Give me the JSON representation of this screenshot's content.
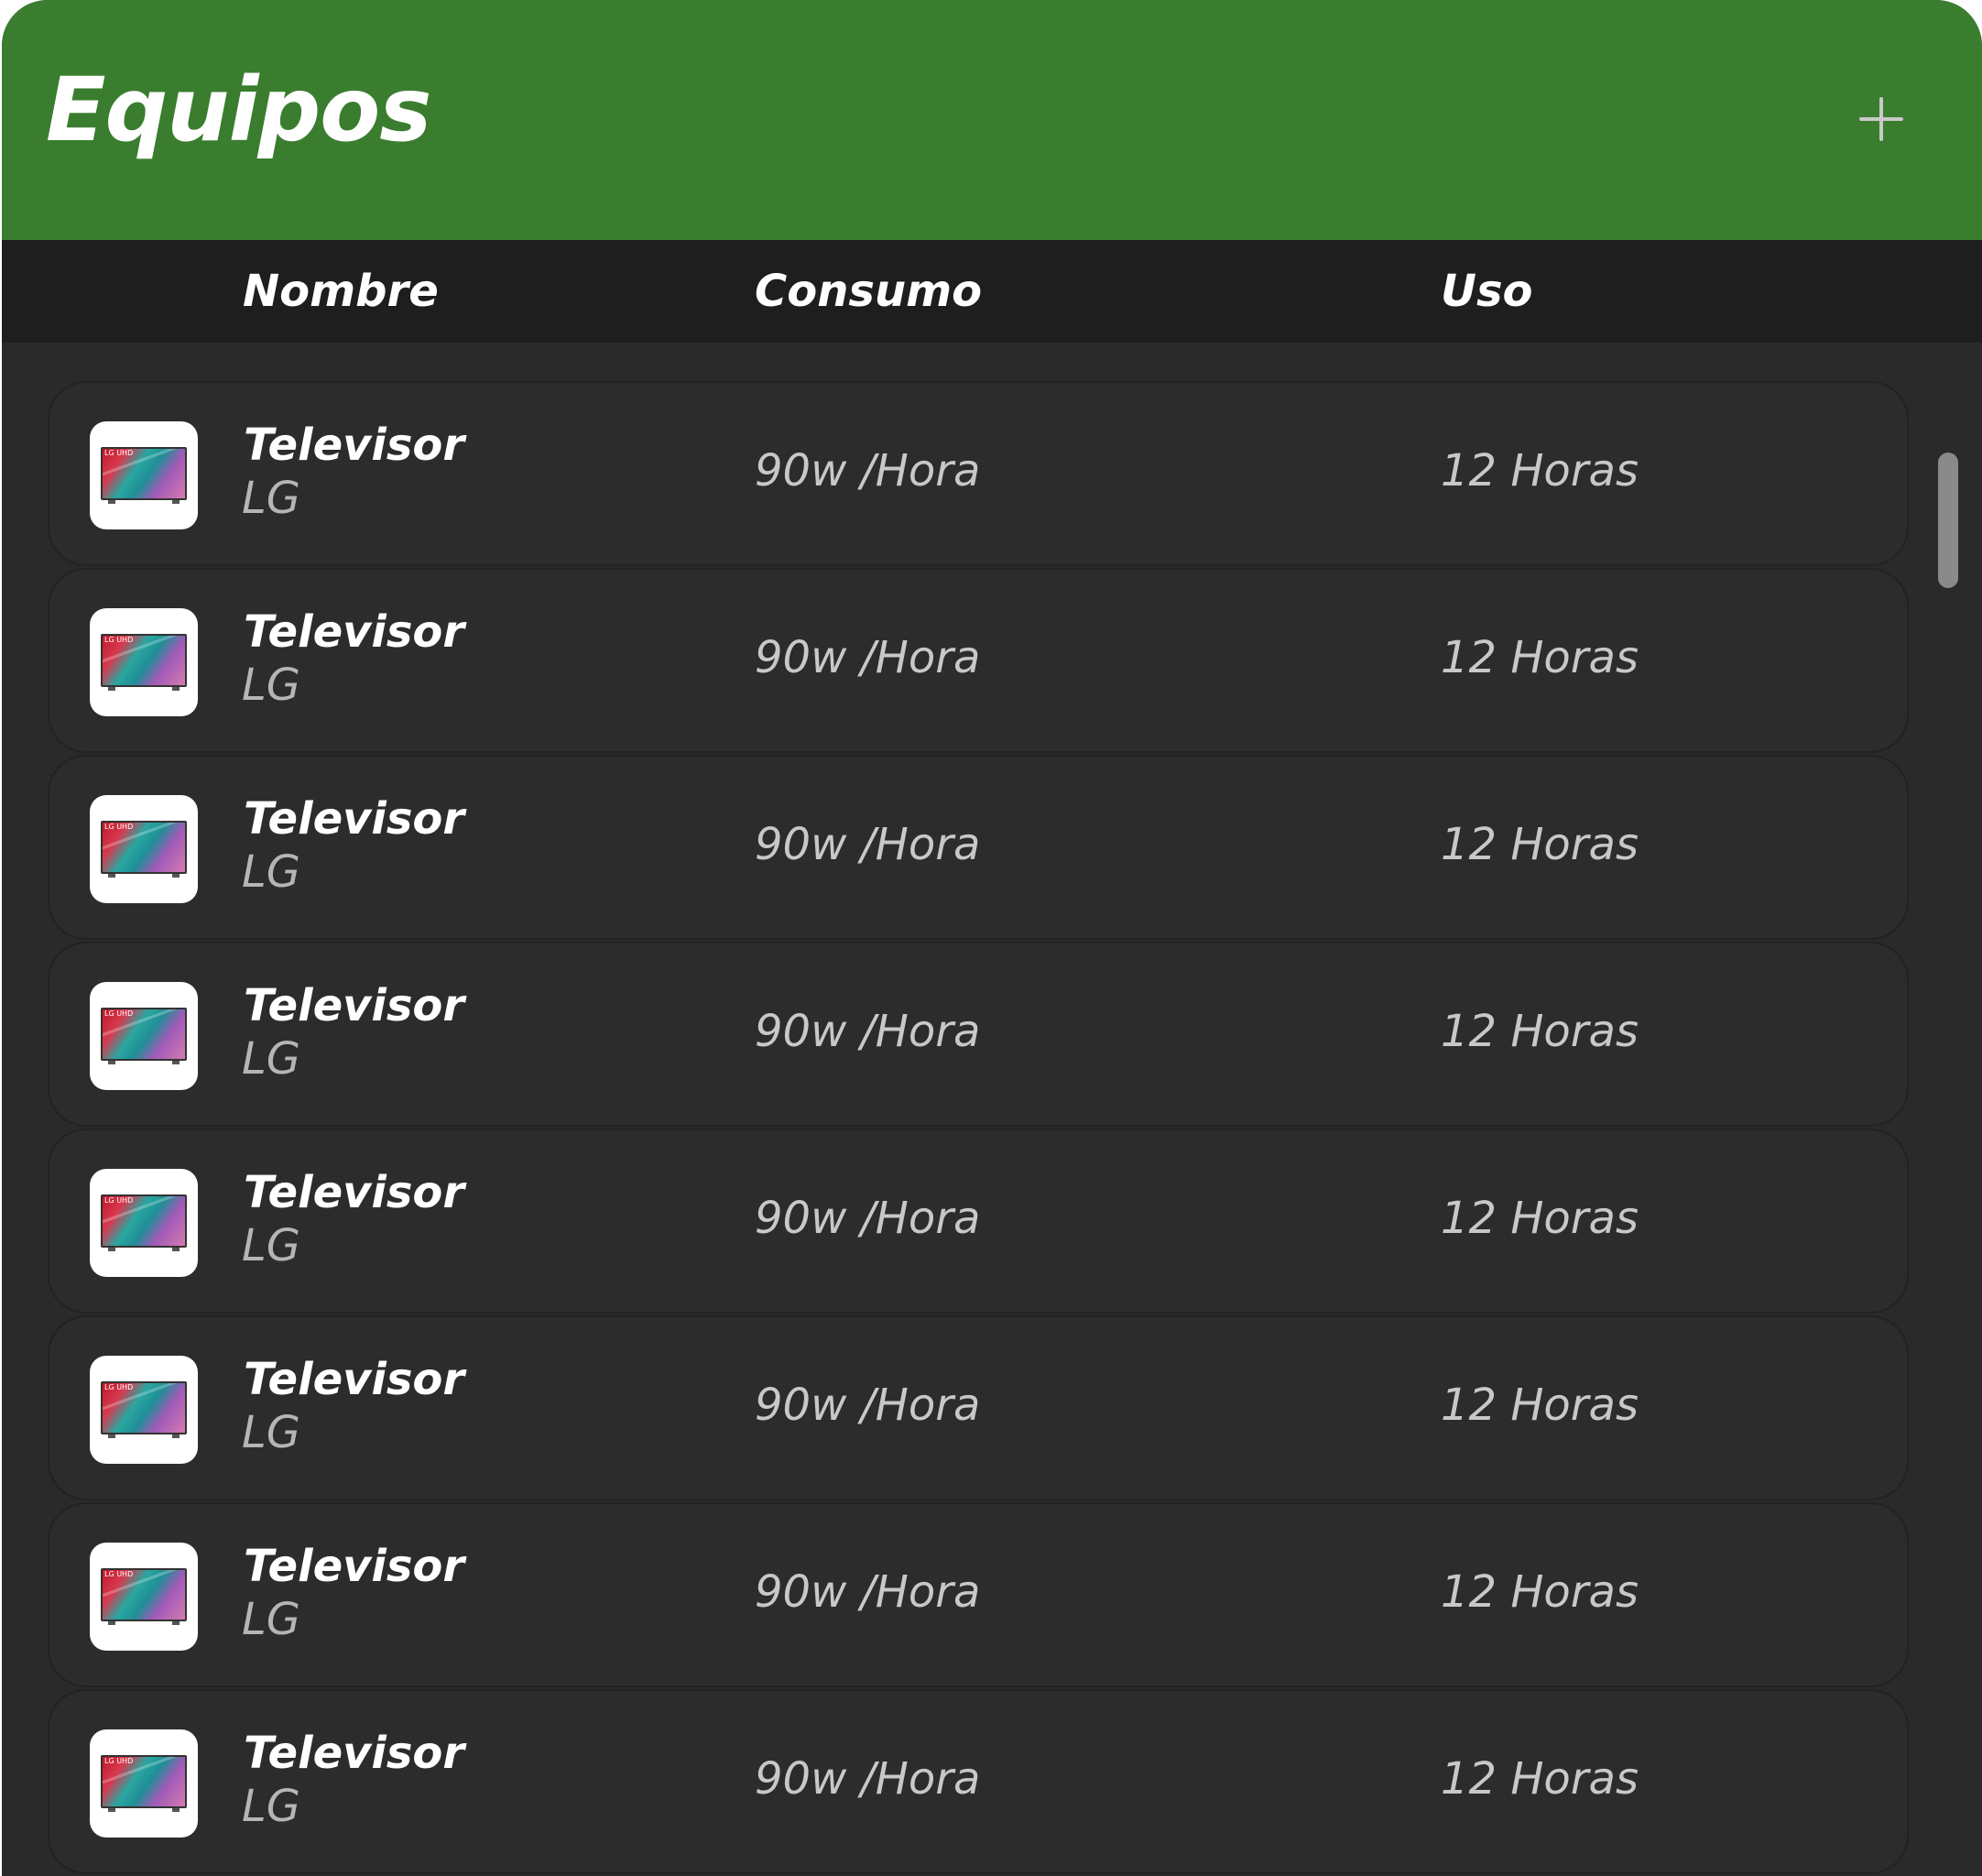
{
  "header": {
    "title": "Equipos",
    "add_icon": "plus-icon"
  },
  "columns": {
    "name": "Nombre",
    "consumption": "Consumo",
    "usage": "Uso"
  },
  "rows": [
    {
      "name": "Televisor",
      "brand": "LG",
      "consumption": "90w /Hora",
      "usage": "12 Horas",
      "thumb_label": "LG UHD"
    },
    {
      "name": "Televisor",
      "brand": "LG",
      "consumption": "90w /Hora",
      "usage": "12 Horas",
      "thumb_label": "LG UHD"
    },
    {
      "name": "Televisor",
      "brand": "LG",
      "consumption": "90w /Hora",
      "usage": "12 Horas",
      "thumb_label": "LG UHD"
    },
    {
      "name": "Televisor",
      "brand": "LG",
      "consumption": "90w /Hora",
      "usage": "12 Horas",
      "thumb_label": "LG UHD"
    },
    {
      "name": "Televisor",
      "brand": "LG",
      "consumption": "90w /Hora",
      "usage": "12 Horas",
      "thumb_label": "LG UHD"
    },
    {
      "name": "Televisor",
      "brand": "LG",
      "consumption": "90w /Hora",
      "usage": "12 Horas",
      "thumb_label": "LG UHD"
    },
    {
      "name": "Televisor",
      "brand": "LG",
      "consumption": "90w /Hora",
      "usage": "12 Horas",
      "thumb_label": "LG UHD"
    },
    {
      "name": "Televisor",
      "brand": "LG",
      "consumption": "90w /Hora",
      "usage": "12 Horas",
      "thumb_label": "LG UHD"
    }
  ],
  "colors": {
    "header_bg": "#3a7d2f",
    "column_header_bg": "#1e1e1e",
    "panel_bg": "#2a2a2a"
  }
}
